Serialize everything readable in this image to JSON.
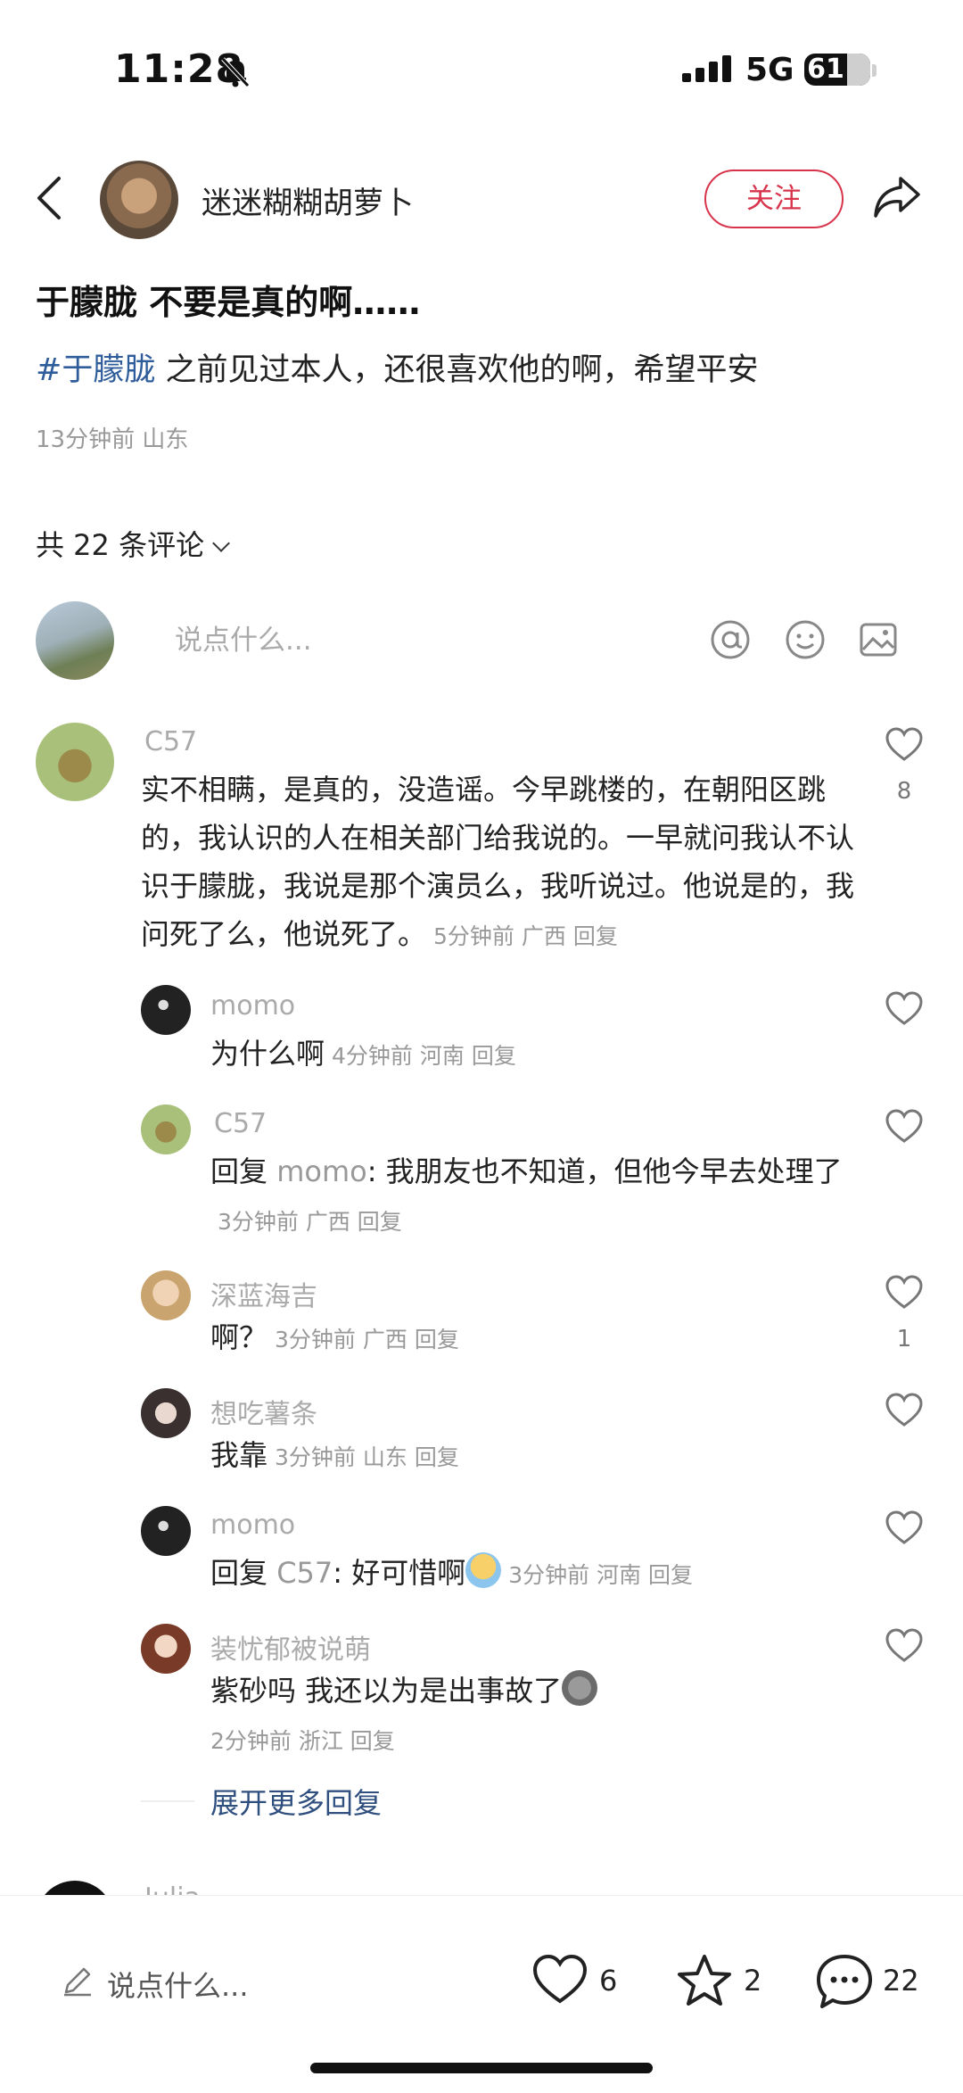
{
  "status_bar": {
    "time": "11:28",
    "network": "5G",
    "battery": "61",
    "battery_level_percent": 61
  },
  "header": {
    "author_name": "迷迷糊糊胡萝卜",
    "follow_label": "关注"
  },
  "post": {
    "title": "于朦胧 不要是真的啊……",
    "hashtag": "#于朦胧",
    "body": " 之前见过本人，还很喜欢他的啊，希望平安",
    "meta": "13分钟前 山东"
  },
  "comments_header": {
    "count_label": "共 22 条评论"
  },
  "comment_input": {
    "placeholder": "说点什么..."
  },
  "comments": [
    {
      "name": "C57",
      "text": "实不相瞒，是真的，没造谣。今早跳楼的，在朝阳区跳的，我认识的人在相关部门给我说的。一早就问我认不认识于朦胧，我说是那个演员么，我听说过。他说是的，我问死了么，他说死了。",
      "meta": "5分钟前 广西 回复",
      "likes": "8",
      "replies": [
        {
          "name": "momo",
          "text": "为什么啊",
          "meta": "4分钟前 河南 回复"
        },
        {
          "name": "C57",
          "reply_prefix": "回复 ",
          "reply_to": "momo",
          "text": ": 我朋友也不知道，但他今早去处理了",
          "meta": "3分钟前 广西 回复"
        },
        {
          "name": "深蓝海吉",
          "text": "啊？",
          "meta": "3分钟前 广西 回复",
          "likes": "1"
        },
        {
          "name": "想吃薯条",
          "text": "我靠",
          "meta": "3分钟前 山东 回复"
        },
        {
          "name": "momo",
          "reply_prefix": "回复 ",
          "reply_to": "C57",
          "text": ": 好可惜啊",
          "meta": "3分钟前 河南 回复"
        },
        {
          "name": "装忧郁被说萌",
          "text": "紫砂吗 我还以为是出事故了",
          "meta": "2分钟前 浙江 回复"
        }
      ],
      "more_replies": "展开更多回复"
    }
  ],
  "next_comment_name": "Julia",
  "bottom_bar": {
    "input_label": "说点什么...",
    "likes": "6",
    "stars": "2",
    "comments": "22"
  },
  "colors": {
    "accent": "#d8344c",
    "hashtag": "#2f5c9a",
    "muted": "#999999",
    "link": "#2f4f7f"
  },
  "icons": [
    "back-icon",
    "share-icon",
    "at-icon",
    "emoji-icon",
    "image-icon",
    "heart-icon",
    "star-icon",
    "chat-bubble-icon",
    "pencil-icon",
    "bell-mute-icon",
    "signal-icon"
  ]
}
